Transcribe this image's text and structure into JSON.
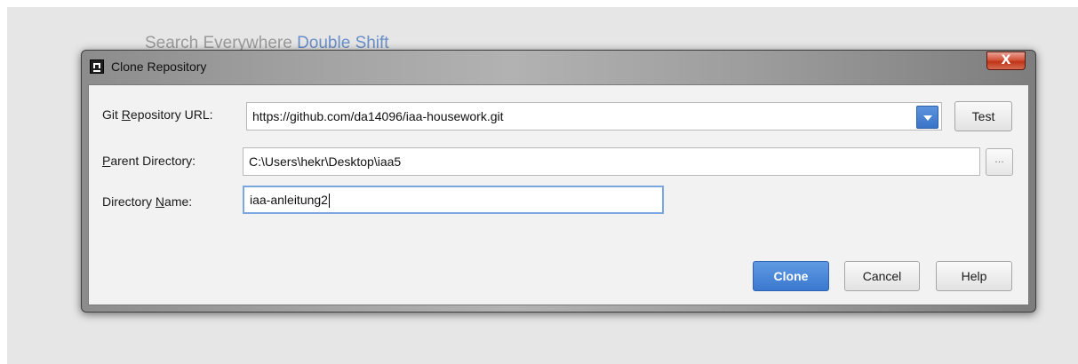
{
  "background": {
    "hint_text": "Search Everywhere",
    "hint_shortcut": "Double Shift"
  },
  "dialog": {
    "title": "Clone Repository",
    "close_label": "X",
    "app_icon": "intellij-idea-icon",
    "fields": {
      "repo_url": {
        "label_prefix": "Git ",
        "label_mnemonic": "R",
        "label_rest": "epository URL:",
        "value": "https://github.com/da14096/iaa-housework.git"
      },
      "parent_dir": {
        "label_prefix": "",
        "label_mnemonic": "P",
        "label_rest": "arent Directory:",
        "value": "C:\\Users\\hekr\\Desktop\\iaa5",
        "browse_label": "..."
      },
      "dir_name": {
        "label_prefix": "Directory ",
        "label_mnemonic": "N",
        "label_rest": "ame:",
        "value": "iaa-anleitung2"
      }
    },
    "buttons": {
      "test": "Test",
      "clone": "Clone",
      "cancel": "Cancel",
      "help": "Help"
    },
    "colors": {
      "primary_button": "#3b78cf",
      "focus_ring": "#7aa7e0",
      "close_button": "#c7401f"
    }
  }
}
